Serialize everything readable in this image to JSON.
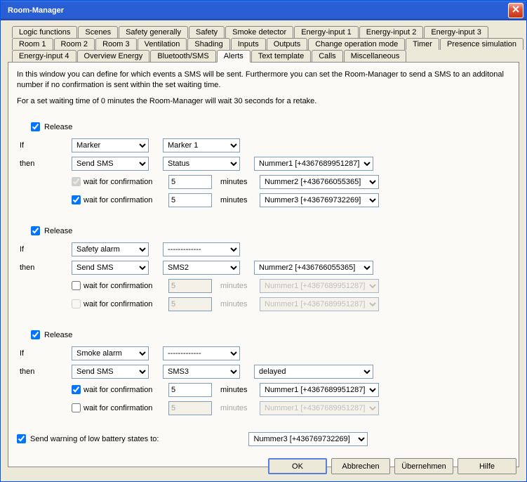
{
  "window": {
    "title": "Room-Manager"
  },
  "tabs": {
    "row1": [
      "Logic functions",
      "Scenes",
      "Safety generally",
      "Safety",
      "Smoke detector",
      "Energy-input 1",
      "Energy-input 2",
      "Energy-input 3"
    ],
    "row2": [
      "Room 1",
      "Room 2",
      "Room 3",
      "Ventilation",
      "Shading",
      "Inputs",
      "Outputs",
      "Change operation mode",
      "Timer",
      "Presence simulation"
    ],
    "row3": [
      "Energy-input 4",
      "Overview Energy",
      "Bluetooth/SMS",
      "Alerts",
      "Text template",
      "Calls",
      "Miscellaneous"
    ],
    "active": "Alerts"
  },
  "description": {
    "line1": "In this window you can define for which events a SMS will be sent. Furthermore you can set the Room-Manager to send a SMS to an additonal number if no confirmation is sent within the set waiting time.",
    "line2": "For a set waiting time of 0 minutes the Room-Manager will wait 30 seconds for a retake."
  },
  "labels": {
    "release": "Release",
    "if": "If",
    "then": "then",
    "wait": "wait for confirmation",
    "minutes": "minutes",
    "lowbatt": "Send warning of low battery states to:"
  },
  "sections": [
    {
      "released": true,
      "if_a": "Marker",
      "if_b": "Marker 1",
      "then_a": "Send SMS",
      "then_b": "Status",
      "then_c": "Nummer1 [+4367689951287]",
      "wait1_checked": true,
      "wait1_disabled": true,
      "wait1_min": "5",
      "wait1_min_disabled": false,
      "wait1_c": "Nummer2 [+436766055365]",
      "wait2_checked": true,
      "wait2_disabled": false,
      "wait2_min": "5",
      "wait2_min_disabled": false,
      "wait2_c": "Nummer3 [+436769732269]"
    },
    {
      "released": true,
      "if_a": "Safety alarm",
      "if_b": "-------------",
      "then_a": "Send SMS",
      "then_b": "SMS2",
      "then_c": "Nummer2 [+436766055365]",
      "wait1_checked": false,
      "wait1_disabled": false,
      "wait1_min": "5",
      "wait1_min_disabled": true,
      "wait1_c": "Nummer1 [+4367689951287]",
      "wait1_c_disabled": true,
      "wait2_checked": false,
      "wait2_disabled": true,
      "wait2_min": "5",
      "wait2_min_disabled": true,
      "wait2_c": "Nummer1 [+4367689951287]",
      "wait2_c_disabled": true
    },
    {
      "released": true,
      "if_a": "Smoke alarm",
      "if_b": "-------------",
      "then_a": "Send SMS",
      "then_b": "SMS3",
      "then_c": "delayed",
      "wait1_checked": true,
      "wait1_disabled": false,
      "wait1_min": "5",
      "wait1_min_disabled": false,
      "wait1_c": "Nummer1 [+4367689951287]",
      "wait2_checked": false,
      "wait2_disabled": false,
      "wait2_min": "5",
      "wait2_min_disabled": true,
      "wait2_c": "Nummer1 [+4367689951287]",
      "wait2_c_disabled": true
    }
  ],
  "lowbatt": {
    "checked": true,
    "dest": "Nummer3 [+436769732269]"
  },
  "buttons": {
    "ok": "OK",
    "cancel": "Abbrechen",
    "apply": "Übernehmen",
    "help": "Hilfe"
  }
}
